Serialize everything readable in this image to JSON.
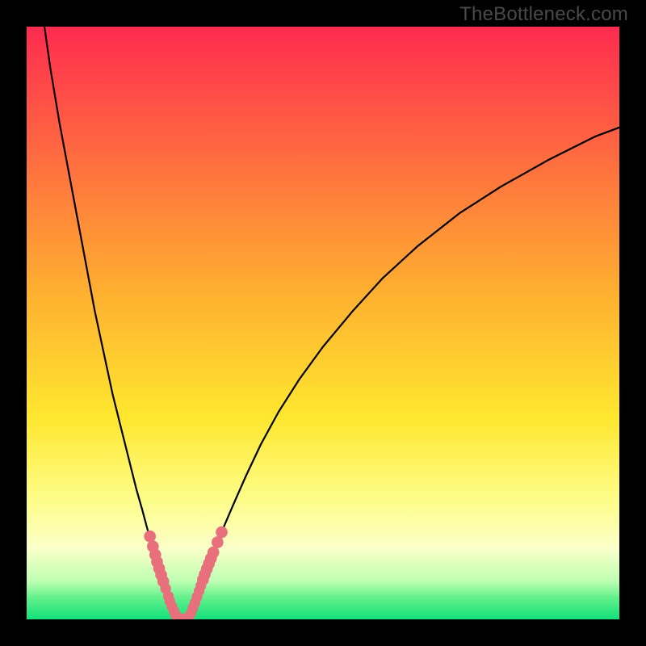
{
  "watermark": "TheBottleneck.com",
  "chart_data": {
    "type": "line",
    "title": "",
    "xlabel": "",
    "ylabel": "",
    "xlim": [
      0,
      100
    ],
    "ylim": [
      0,
      100
    ],
    "gradient_stops": [
      {
        "offset": 0,
        "color": "#ff2b4f"
      },
      {
        "offset": 0.45,
        "color": "#ffb030"
      },
      {
        "offset": 0.66,
        "color": "#ffe72f"
      },
      {
        "offset": 0.8,
        "color": "#fdfd8a"
      },
      {
        "offset": 0.88,
        "color": "#fbffc9"
      },
      {
        "offset": 0.935,
        "color": "#bfffb3"
      },
      {
        "offset": 0.965,
        "color": "#5ff08a"
      },
      {
        "offset": 1.0,
        "color": "#12e07a"
      }
    ],
    "series": [
      {
        "name": "left-branch",
        "x": [
          3.0,
          4.0,
          5.5,
          7.0,
          8.5,
          10.0,
          11.5,
          13.0,
          14.5,
          16.0,
          17.5,
          18.5,
          19.5,
          20.3,
          21.0,
          21.8,
          22.5,
          23.1,
          23.7,
          24.2,
          24.6,
          24.9,
          25.1
        ],
        "y": [
          100,
          93,
          84,
          76,
          68,
          60,
          52,
          45,
          38,
          32,
          26,
          22,
          18.5,
          15.5,
          13,
          10.5,
          8.3,
          6.4,
          4.8,
          3.4,
          2.2,
          1.2,
          0.4
        ]
      },
      {
        "name": "right-branch",
        "x": [
          27.4,
          27.8,
          28.3,
          28.9,
          29.6,
          30.5,
          31.6,
          33.0,
          34.8,
          37.0,
          39.5,
          42.5,
          46.0,
          50.0,
          55.0,
          60.0,
          66.0,
          73.0,
          80.0,
          88.0,
          96.0,
          100.0
        ],
        "y": [
          0.4,
          1.3,
          2.6,
          4.2,
          6.2,
          8.6,
          11.4,
          15.0,
          19.2,
          24.2,
          29.5,
          35.0,
          40.5,
          46.0,
          52.0,
          57.5,
          63.0,
          68.5,
          73.0,
          77.5,
          81.5,
          83.0
        ]
      }
    ],
    "markers": [
      {
        "x": 20.8,
        "y": 14.0,
        "r": 1.0
      },
      {
        "x": 21.3,
        "y": 12.3,
        "r": 1.0
      },
      {
        "x": 21.7,
        "y": 10.9,
        "r": 1.0
      },
      {
        "x": 22.0,
        "y": 9.7,
        "r": 1.0
      },
      {
        "x": 22.35,
        "y": 8.6,
        "r": 1.0
      },
      {
        "x": 22.7,
        "y": 7.5,
        "r": 1.0
      },
      {
        "x": 23.05,
        "y": 6.4,
        "r": 1.0
      },
      {
        "x": 23.45,
        "y": 5.2,
        "r": 0.9
      },
      {
        "x": 23.9,
        "y": 3.9,
        "r": 0.9
      },
      {
        "x": 24.15,
        "y": 3.1,
        "r": 0.9
      },
      {
        "x": 24.5,
        "y": 2.2,
        "r": 0.9
      },
      {
        "x": 24.85,
        "y": 1.4,
        "r": 0.9
      },
      {
        "x": 25.15,
        "y": 0.7,
        "r": 0.9
      },
      {
        "x": 25.5,
        "y": 0.3,
        "r": 0.9
      },
      {
        "x": 26.0,
        "y": 0.12,
        "r": 0.9
      },
      {
        "x": 26.5,
        "y": 0.08,
        "r": 0.9
      },
      {
        "x": 27.0,
        "y": 0.15,
        "r": 0.9
      },
      {
        "x": 27.35,
        "y": 0.45,
        "r": 0.9
      },
      {
        "x": 27.7,
        "y": 1.0,
        "r": 0.9
      },
      {
        "x": 28.05,
        "y": 1.9,
        "r": 0.9
      },
      {
        "x": 28.4,
        "y": 2.8,
        "r": 0.9
      },
      {
        "x": 28.75,
        "y": 3.8,
        "r": 0.9
      },
      {
        "x": 29.1,
        "y": 4.8,
        "r": 0.9
      },
      {
        "x": 29.4,
        "y": 5.7,
        "r": 0.9
      },
      {
        "x": 29.75,
        "y": 6.7,
        "r": 1.0
      },
      {
        "x": 30.05,
        "y": 7.6,
        "r": 1.0
      },
      {
        "x": 30.4,
        "y": 8.5,
        "r": 1.0
      },
      {
        "x": 30.75,
        "y": 9.4,
        "r": 1.0
      },
      {
        "x": 31.1,
        "y": 10.3,
        "r": 1.0
      },
      {
        "x": 31.5,
        "y": 11.3,
        "r": 1.0
      },
      {
        "x": 32.2,
        "y": 13.0,
        "r": 1.0
      },
      {
        "x": 32.9,
        "y": 14.7,
        "r": 1.0
      }
    ],
    "marker_color": "#e8707c",
    "curve_color": "#000000"
  }
}
